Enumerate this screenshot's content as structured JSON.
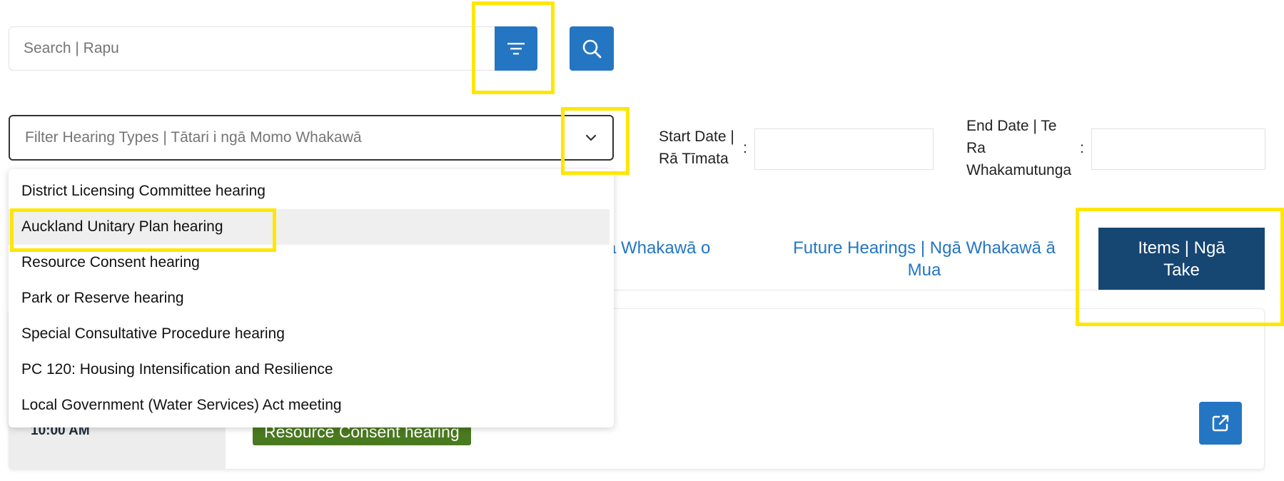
{
  "search": {
    "placeholder": "Search | Rapu",
    "value": ""
  },
  "filter_select": {
    "placeholder": "Filter Hearing Types | Tātari i ngā Momo Whakawā",
    "options": [
      "District Licensing Committee hearing",
      "Auckland Unitary Plan hearing",
      "Resource Consent hearing",
      "Park or Reserve hearing",
      "Special Consultative Procedure hearing",
      "PC 120: Housing Intensification and Resilience",
      "Local Government (Water Services) Act meeting"
    ],
    "hovered_option": "Auckland Unitary Plan hearing"
  },
  "dates": {
    "start_label_line1": "Start Date |",
    "start_label_line2": "Rā Tīmata",
    "end_label_line1": "End Date | Te",
    "end_label_line2": "Ra",
    "end_label_line3": "Whakamutunga",
    "colon": ":"
  },
  "tabs": {
    "partial_tab": "ā Whakawā o",
    "future_line1": "Future Hearings | Ngā Whakawā ā",
    "future_line2": "Mua",
    "items_line1": "Items | Ngā",
    "items_line2": "Take"
  },
  "card": {
    "time": "10:00 AM",
    "badge": "Resource Consent hearing"
  },
  "colors": {
    "primary": "#2476c2",
    "active_tab": "#164672",
    "badge": "#4a7a1f",
    "highlight": "#ffe600"
  }
}
